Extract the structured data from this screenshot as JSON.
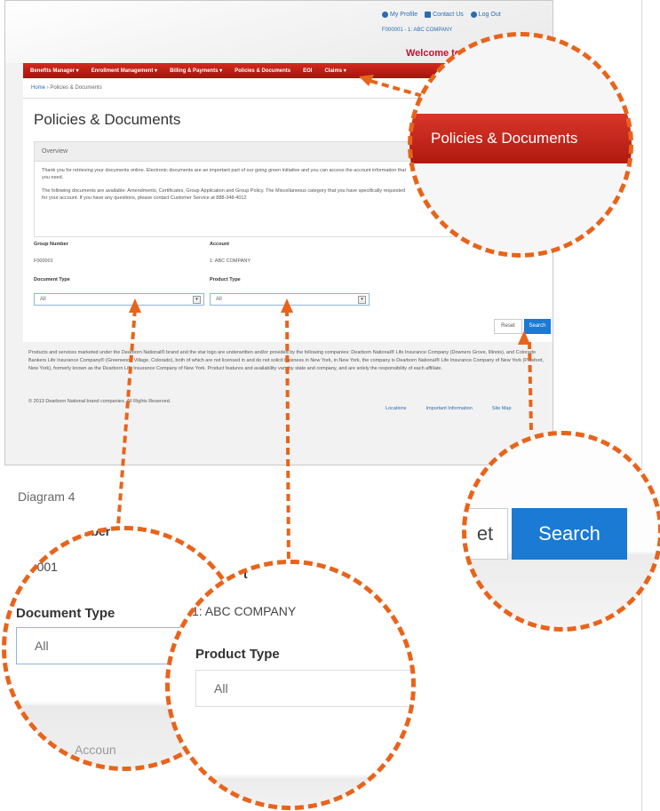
{
  "page": {
    "top_links": {
      "profile": "My Profile",
      "contact": "Contact Us",
      "logout": "Log Out"
    },
    "account_line": "F000001 - 1: ABC COMPANY",
    "welcome": "Welcome to D",
    "nav": [
      "Benefits Manager ▾",
      "Enrollment Management ▾",
      "Billing & Payments ▾",
      "Policies & Documents",
      "EOI",
      "Claims ▾"
    ],
    "breadcrumb": {
      "home": "Home",
      "sep": "›",
      "current": "Policies & Documents"
    },
    "title": "Policies & Documents",
    "overview": {
      "header": "Overview",
      "p1": "Thank you for retrieving your documents online. Electronic documents are an important part of our going green initiative and",
      "p1b": "you can access the account information that you need.",
      "p2": "The following documents are available: Amendments, Certificates, Group Application and Group Policy. The Miscellaneous category",
      "p2b": "that you have specifically requested for your account. If you have any questions, please contact Customer Service at 888-348-4012"
    },
    "fields": {
      "group_label": "Group Number",
      "group_value": "F000001",
      "account_label": "Account",
      "account_value": "1: ABC COMPANY",
      "doc_type_label": "Document Type",
      "doc_type_value": "All",
      "product_type_label": "Product Type",
      "product_type_value": "All"
    },
    "buttons": {
      "reset": "Reset",
      "search": "Search"
    },
    "footer_text": "Products and services marketed under the Dearborn National® brand and the star logo are underwritten and/or provided by the following companies: Dearborn National® Life Insurance Company (Downers Grove, Illinois), and Colorado Bankers Life Insurance Company® (Greenwood Village, Colorado), both of which are not licensed in and do not solicit business in New York, in New York, the company is Dearborn National® Life Insurance Company of New York (Pittsford, New York), formerly known as the Dearborn Life Insurance Company of New York. Product features and availability vary by state and company, and are solely the responsibility of each affiliate.",
    "copyright": "© 2013 Dearborn National brand companies. All Rights Reserved.",
    "footer_links": [
      "Locations",
      "Important Information",
      "Site Map"
    ]
  },
  "caption": "Diagram 4",
  "zooms": {
    "nav": {
      "label": "Policies & Documents"
    },
    "search": {
      "reset_partial": "et",
      "search": "Search"
    },
    "doc": {
      "group_partial": "mber",
      "group_value_partial": "00001",
      "label": "Document Type",
      "value": "All",
      "next_partial": "Accoun"
    },
    "product": {
      "account_partial": "t",
      "account_value": "1: ABC COMPANY",
      "label": "Product Type",
      "value": "All"
    }
  },
  "colors": {
    "annotation": "#e8641b",
    "nav_red": "#c41e14",
    "search_blue": "#1a7ad4",
    "welcome_red": "#c8102e"
  },
  "icons": {
    "profile": "person-icon",
    "contact": "envelope-icon",
    "logout": "power-icon",
    "select": "dropdown-arrow-icon"
  }
}
